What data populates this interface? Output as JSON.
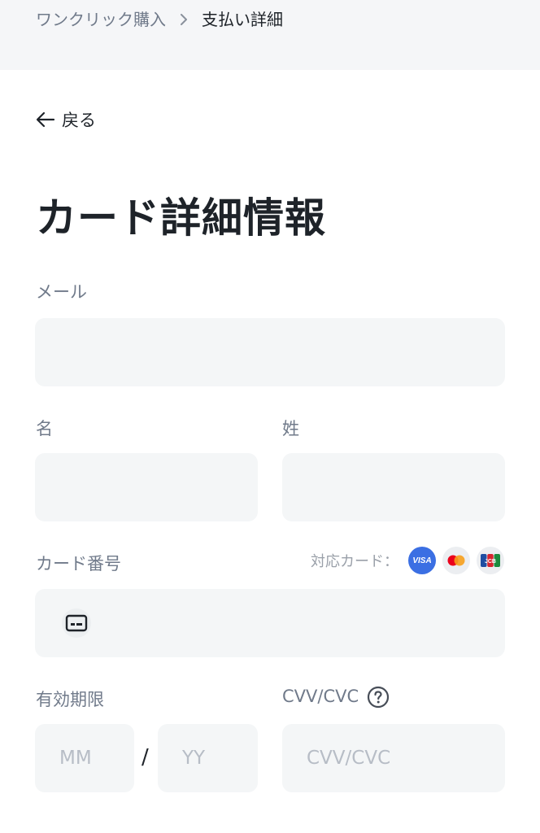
{
  "breadcrumb": {
    "parent": "ワンクリック購入",
    "current": "支払い詳細"
  },
  "back_label": "戻る",
  "page_title": "カード詳細情報",
  "form": {
    "email_label": "メール",
    "email_value": "",
    "first_name_label": "名",
    "first_name_value": "",
    "last_name_label": "姓",
    "last_name_value": "",
    "card_number_label": "カード番号",
    "card_number_value": "",
    "accepted_cards_label": "対応カード：",
    "accepted_cards": [
      "VISA",
      "Mastercard",
      "JCB"
    ],
    "expiry_label": "有効期限",
    "expiry_month_placeholder": "MM",
    "expiry_year_placeholder": "YY",
    "expiry_separator": "/",
    "cvv_label": "CVV/CVC",
    "cvv_placeholder": "CVV/CVC"
  },
  "icons": {
    "breadcrumb_separator": "chevron-right-icon",
    "back": "arrow-left-icon",
    "card": "credit-card-icon",
    "help": "question-circle-icon"
  },
  "colors": {
    "topbar_bg": "#f5f6f8",
    "field_bg": "#f4f6f7",
    "text_primary": "#1e2329",
    "text_secondary": "#707a8a",
    "visa_blue": "#3b6fe3",
    "mastercard_red": "#eb001b",
    "mastercard_orange": "#f79e1b"
  }
}
